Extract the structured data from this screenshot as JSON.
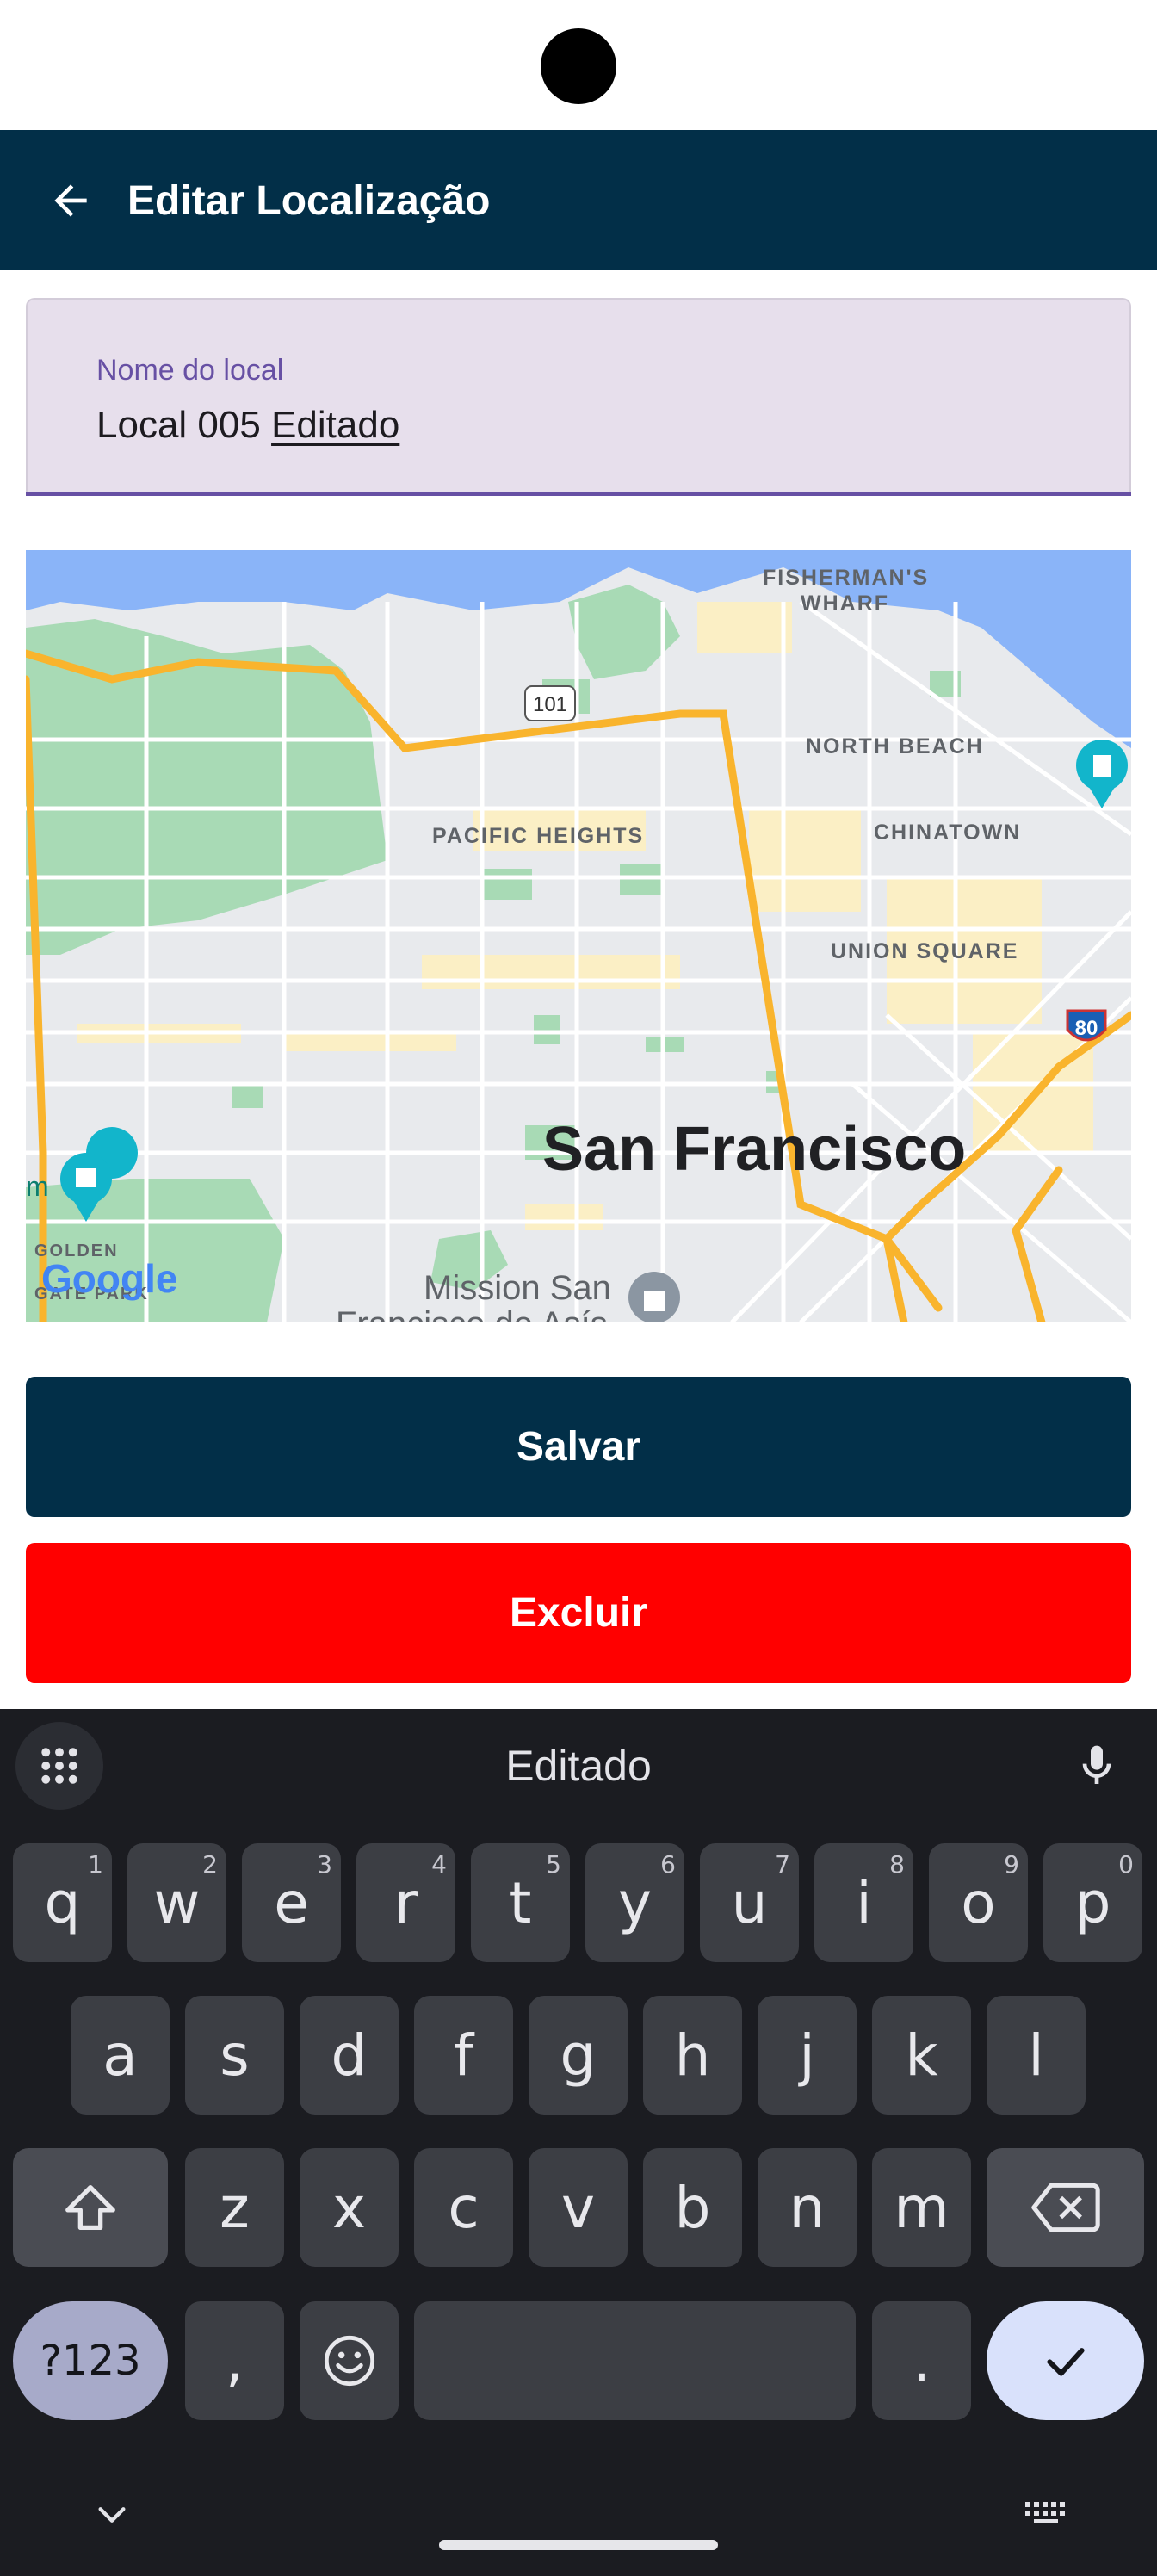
{
  "app_bar": {
    "title": "Editar Localização",
    "back_icon": "arrow-back-icon",
    "background": "#022f48"
  },
  "location_field": {
    "label": "Nome do local",
    "value_prefix": "Local 005 ",
    "value_composing": "Editado"
  },
  "map": {
    "labels": {
      "fishermans_wharf_1": "FISHERMAN'S",
      "fishermans_wharf_2": "WHARF",
      "north_beach": "NORTH BEACH",
      "pacific_heights": "PACIFIC HEIGHTS",
      "chinatown": "CHINATOWN",
      "union_square": "UNION SQUARE",
      "city": "San Francisco",
      "mission": "Mission San",
      "mission_2": "Francisco de Asís",
      "highway_101": "101",
      "highway_80": "80",
      "golden_gate_park": "GOLDEN",
      "golden_gate_park_2": "GATE PARK",
      "google": "Google",
      "edge_m": "m"
    }
  },
  "actions": {
    "save_label": "Salvar",
    "delete_label": "Excluir",
    "save_color": "#022f48",
    "delete_color": "#ff0000"
  },
  "keyboard": {
    "suggestion": "Editado",
    "row1": [
      {
        "key": "q",
        "hint": "1"
      },
      {
        "key": "w",
        "hint": "2"
      },
      {
        "key": "e",
        "hint": "3"
      },
      {
        "key": "r",
        "hint": "4"
      },
      {
        "key": "t",
        "hint": "5"
      },
      {
        "key": "y",
        "hint": "6"
      },
      {
        "key": "u",
        "hint": "7"
      },
      {
        "key": "i",
        "hint": "8"
      },
      {
        "key": "o",
        "hint": "9"
      },
      {
        "key": "p",
        "hint": "0"
      }
    ],
    "row2": [
      "a",
      "s",
      "d",
      "f",
      "g",
      "h",
      "j",
      "k",
      "l"
    ],
    "row3": [
      "z",
      "x",
      "c",
      "v",
      "b",
      "n",
      "m"
    ],
    "symbols_label": "?123",
    "comma": ",",
    "period": "."
  }
}
